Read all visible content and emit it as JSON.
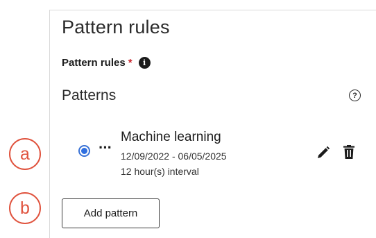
{
  "panel": {
    "title": "Pattern rules",
    "field_label": "Pattern rules",
    "required_marker": "*",
    "info_icon_glyph": "i",
    "section_title": "Patterns",
    "help_icon_glyph": "?"
  },
  "patterns": [
    {
      "name": "Machine learning",
      "dates": "12/09/2022 - 06/05/2025",
      "interval": "12 hour(s) interval",
      "selected": true,
      "drag_handle": "···"
    }
  ],
  "actions": {
    "add_pattern_label": "Add pattern"
  },
  "callouts": {
    "a": "a",
    "b": "b"
  },
  "colors": {
    "accent": "#2f6fe0",
    "required": "#c9252c",
    "callout": "#e0533e",
    "text": "#1b1b1b",
    "border": "#d9d9d9"
  },
  "icons": {
    "info": "info-icon",
    "help": "help-icon",
    "edit": "pencil-icon",
    "delete": "trash-icon",
    "drag": "drag-handle-icon"
  }
}
